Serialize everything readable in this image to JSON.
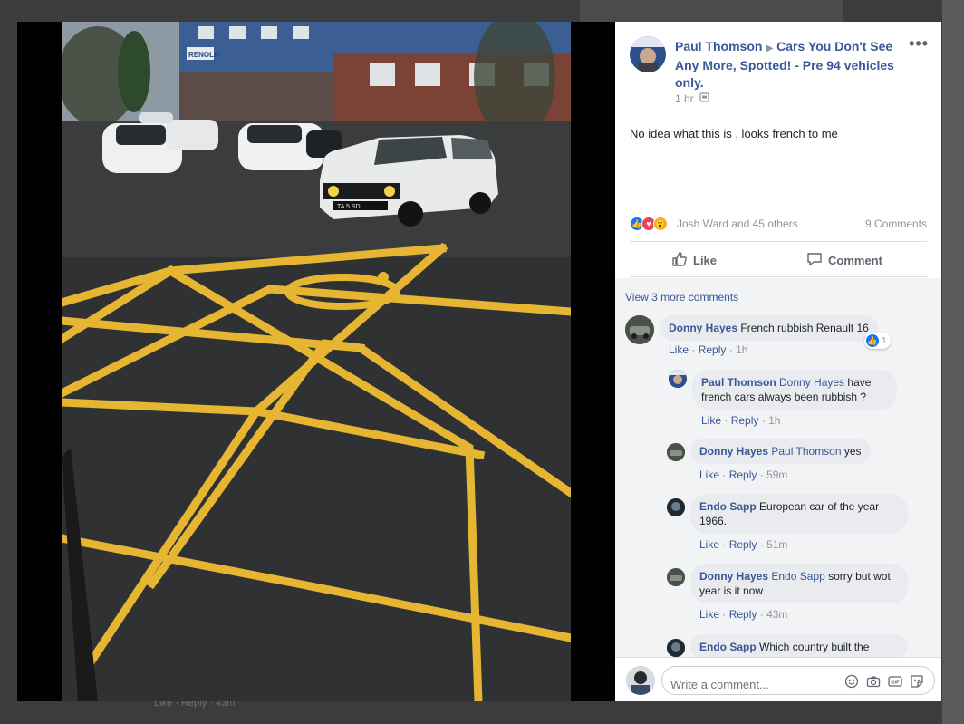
{
  "post": {
    "author": "Paul Thomson",
    "group": "Cars You Don't See Any More, Spotted! - Pre 94 vehicles only.",
    "time": "1 hr",
    "text": "No idea what this is , looks french to me",
    "reaction_names": "Josh Ward and 45 others",
    "comments_count": "9 Comments",
    "like_label": "Like",
    "comment_label": "Comment"
  },
  "comments_section": {
    "view_more": "View 3 more comments",
    "items": [
      {
        "author": "Donny Hayes",
        "mention": "",
        "text": "French rubbish Renault 16",
        "like": "Like",
        "reply": "Reply",
        "time": "1h",
        "reactions": "1"
      },
      {
        "author": "Paul Thomson",
        "mention": "Donny Hayes",
        "text": "have french cars always been rubbish ?",
        "like": "Like",
        "reply": "Reply",
        "time": "1h"
      },
      {
        "author": "Donny Hayes",
        "mention": "Paul Thomson",
        "text": "yes",
        "like": "Like",
        "reply": "Reply",
        "time": "59m"
      },
      {
        "author": "Endo Sapp",
        "mention": "",
        "text": "European car of the year 1966.",
        "like": "Like",
        "reply": "Reply",
        "time": "51m"
      },
      {
        "author": "Donny Hayes",
        "mention": "Endo Sapp",
        "text": "sorry but wot year is it now",
        "like": "Like",
        "reply": "Reply",
        "time": "43m"
      },
      {
        "author": "Endo Sapp",
        "mention": "",
        "text": "Which country built the"
      }
    ],
    "separator": "·"
  },
  "write_comment": {
    "placeholder": "Write a comment..."
  },
  "photo": {
    "plate_text": "TA 5 SD",
    "sign_text": "RENOLD"
  },
  "background": {
    "bottom_text": "Like · Reply · 43m"
  },
  "colors": {
    "link": "#385898",
    "meta": "#90949c",
    "bubble": "#e9ebee",
    "like_blue": "#1877f2",
    "love_red": "#f33e58",
    "wow_yellow": "#f7b125",
    "line_yellow": "#e6b532"
  },
  "icons": [
    "more-icon",
    "globe-icon",
    "like-reaction-icon",
    "love-reaction-icon",
    "wow-reaction-icon",
    "thumbs-up-icon",
    "comment-bubble-icon",
    "emoji-icon",
    "camera-icon",
    "gif-icon",
    "sticker-icon"
  ]
}
